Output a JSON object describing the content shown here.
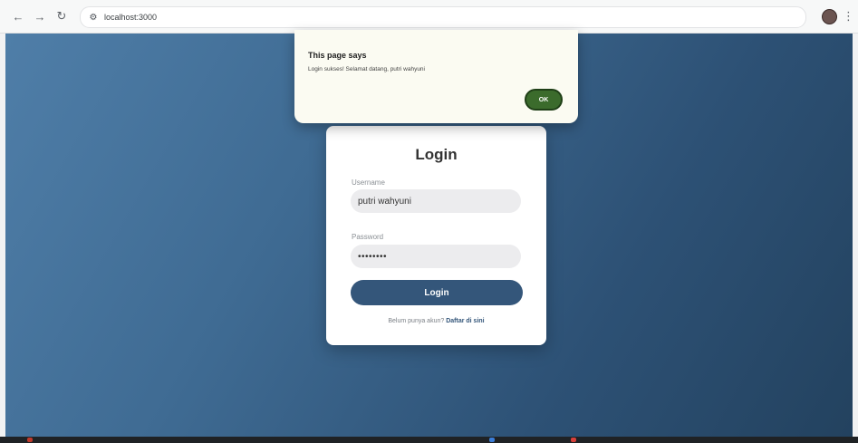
{
  "browser": {
    "url": "localhost:3000",
    "back_glyph": "←",
    "forward_glyph": "→",
    "reload_glyph": "↻",
    "site_info_glyph": "⚙",
    "menu_glyph": "⋮"
  },
  "login": {
    "title": "Login",
    "username_label": "Username",
    "username_value": "putri wahyuni",
    "password_label": "Password",
    "password_value": "••••••••",
    "button_label": "Login",
    "register_prompt": "Belum punya akun?",
    "register_link": "Daftar di sini"
  },
  "alert": {
    "title": "This page says",
    "message": "Login sukses! Selamat datang, putri wahyuni",
    "ok_label": "OK"
  },
  "colors": {
    "accent": "#34567a",
    "ok_button": "#3b6b2c",
    "dialog_bg": "#fbfbf2"
  }
}
